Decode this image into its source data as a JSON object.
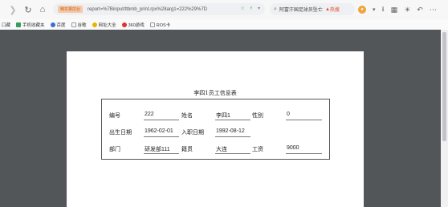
{
  "browser": {
    "safe_tag": "精实量控台",
    "url": "report=%7Binput/ttbmb_print.rpx%28arg1=222%29%7D",
    "search_text": "阿富汗国足球员坠亡",
    "search_hot": "热搜"
  },
  "bookmarks": {
    "first": "口藏",
    "items": [
      "手机收藏夹",
      "百度",
      "谷歌",
      "网址大全",
      "360游戏",
      "ROS卡"
    ]
  },
  "document": {
    "title": "李四1员工信息表",
    "fields": {
      "id_label": "编号",
      "id_value": "222",
      "name_label": "姓名",
      "name_value": "李四1",
      "gender_label": "性别",
      "gender_value": "0",
      "birth_label": "出生日期",
      "birth_value": "1962-02-01",
      "hire_label": "入职日期",
      "hire_value": "1992-08-12",
      "dept_label": "部门",
      "dept_value": "研发部111",
      "origin_label": "籍贯",
      "origin_value": "大连",
      "salary_label": "工资",
      "salary_value": "9000"
    }
  },
  "colors": {
    "preview_bg": "#525659",
    "paper": "#ffffff",
    "safe_tag_bg": "#f7c9a9"
  }
}
